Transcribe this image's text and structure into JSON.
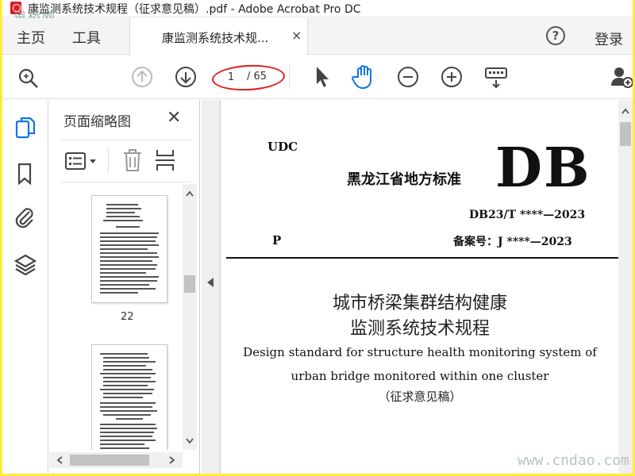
{
  "window": {
    "title": "康监测系统技术规程（征求意见稿）.pdf - Adobe Acrobat Pro DC",
    "watermark_top": "道桥网"
  },
  "tabbar": {
    "home_label": "主页",
    "tools_label": "工具",
    "document_tab_label": "康监测系统技术规...",
    "close_glyph": "×",
    "help_glyph": "?",
    "login_label": "登录"
  },
  "toolbar": {
    "current_page": "1",
    "total_pages": "/ 65",
    "icons": [
      "search-icon",
      "page-up-icon",
      "page-down-icon",
      "select-cursor-icon",
      "hand-icon",
      "zoom-out-icon",
      "zoom-in-icon",
      "keyboard-icon",
      "add-user-icon"
    ]
  },
  "rail": {
    "icons": [
      "page-thumbnails-icon",
      "bookmark-icon",
      "attachment-icon",
      "layers-icon"
    ]
  },
  "thumbnail_panel": {
    "title": "页面缩略图",
    "close_glyph": "✕",
    "page_label": "22"
  },
  "document": {
    "udc": "UDC",
    "db": "DB",
    "standard_name": "黑龙江省地方标准",
    "db_number": "DB23/T ****—2023",
    "p_letter": "P",
    "record_number": "备案号：J ****—2023",
    "title_cn_line1": "城市桥梁集群结构健康",
    "title_cn_line2": "监测系统技术规程",
    "title_en_line1": "Design standard for structure health monitoring system of",
    "title_en_line2": "urban bridge monitored within one cluster",
    "draft_note": "（征求意见稿）"
  },
  "watermark_bottom": "www.cndao.com",
  "colors": {
    "frame_border": "#ffeb3b",
    "accent_blue": "#1473e6",
    "annotation_red": "#e02020"
  }
}
